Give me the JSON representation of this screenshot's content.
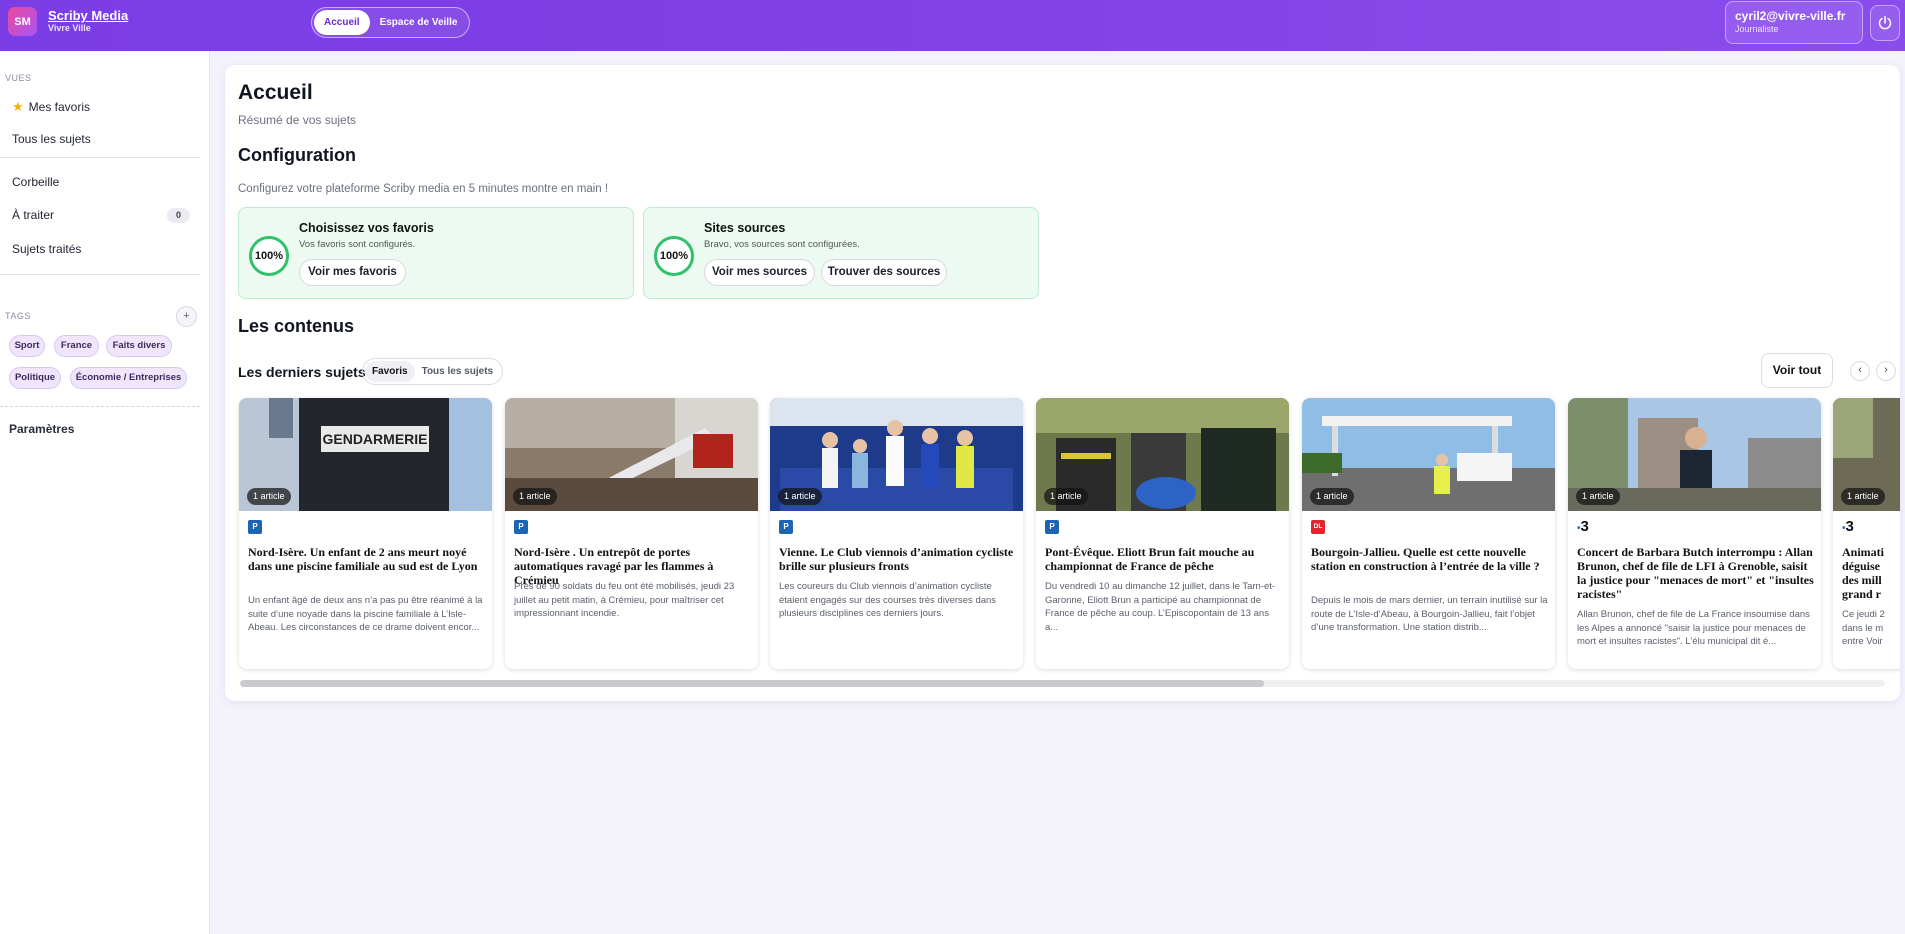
{
  "header": {
    "logo_initials": "SM",
    "brand_name": "Scriby Media",
    "brand_sub": "Vivre Ville",
    "nav": [
      {
        "label": "Accueil",
        "active": true
      },
      {
        "label": "Espace de Veille",
        "active": false
      }
    ],
    "user_email": "cyril2@vivre-ville.fr",
    "user_role": "Journaliste",
    "power_icon": "power-icon"
  },
  "sidebar": {
    "views_label": "VUES",
    "favorites_label": "Mes favoris",
    "all_subjects": "Tous les sujets",
    "trash": "Corbeille",
    "to_process": "À traiter",
    "to_process_count": "0",
    "processed": "Sujets traités",
    "tags_label": "TAGS",
    "add_tag": "+",
    "tags": [
      "Sport",
      "France",
      "Faits divers",
      "Politique",
      "Économie / Entreprises"
    ],
    "settings": "Paramètres"
  },
  "main": {
    "title": "Accueil",
    "subtitle": "Résumé de vos sujets",
    "config_title": "Configuration",
    "config_desc": "Configurez votre plateforme Scriby media en 5 minutes montre en main !",
    "config_cards": [
      {
        "percent": "100%",
        "title": "Choisissez vos favoris",
        "desc": "Vos favoris sont configurés.",
        "buttons": [
          "Voir mes favoris"
        ]
      },
      {
        "percent": "100%",
        "title": "Sites sources",
        "desc": "Bravo, vos sources sont configurées.",
        "buttons": [
          "Voir mes sources",
          "Trouver des sources"
        ]
      }
    ],
    "contents_title": "Les contenus",
    "latest_title": "Les derniers sujets",
    "toggle": [
      "Favoris",
      "Tous les sujets"
    ],
    "see_all": "Voir tout",
    "prev": "‹",
    "next": "›"
  },
  "articles": [
    {
      "badge": "1 article",
      "source": "P",
      "title": "Nord-Isère. Un enfant de 2 ans meurt noyé dans une piscine familiale au sud est de Lyon",
      "desc": "Un enfant âgé de deux ans n’a pas pu être réanimé à la suite d’une noyade dans la piscine familiale à L’Isle-Abeau. Les circonstances de ce drame doivent encor...",
      "img_text": "GENDARMERIE"
    },
    {
      "badge": "1 article",
      "source": "P",
      "title": "Nord-Isère . Un entrepôt de portes automatiques ravagé par les flammes à Crémieu",
      "desc": "Près de 90 soldats du feu ont été mobilisés, jeudi 23 juillet au petit matin, à Crémieu, pour maîtriser cet impressionnant incendie."
    },
    {
      "badge": "1 article",
      "source": "P",
      "title": "Vienne. Le Club viennois d’animation cycliste brille sur plusieurs fronts",
      "desc": "Les coureurs du Club viennois d’animation cycliste étaient engagés sur des courses très diverses dans plusieurs disciplines ces derniers jours."
    },
    {
      "badge": "1 article",
      "source": "P",
      "title": "Pont-Évêque. Eliott Brun fait mouche au championnat de France de pêche",
      "desc": "Du vendredi 10 au dimanche 12 juillet, dans le Tarn-et-Garonne, Eliott Brun a participé au championnat de France de pêche au coup. L’Episcopontain de 13 ans a..."
    },
    {
      "badge": "1 article",
      "source": "DL",
      "title": "Bourgoin-Jallieu. Quelle est cette nouvelle station en construction à l’entrée de la ville ?",
      "desc": "Depuis le mois de mars dernier, un terrain inutilisé sur la route de L’Isle-d’Abeau, à Bourgoin-Jallieu, fait l’objet d’une transformation. Une station distrib..."
    },
    {
      "badge": "1 article",
      "source": "3",
      "title": "Concert de Barbara Butch interrompu : Allan Brunon, chef de file de LFI à Grenoble, saisit la justice pour \"menaces de mort\" et \"insultes racistes\"",
      "desc": "Allan Brunon, chef de file de La France insoumise dans les Alpes a annoncé \"saisir la justice pour menaces de mort et insultes racistes\". L’élu municipal dit é..."
    },
    {
      "badge": "1 article",
      "source": "3",
      "title": "Animati déguise des mill grand r",
      "desc": "Ce jeudi 2 dans le m entre Voir"
    }
  ]
}
